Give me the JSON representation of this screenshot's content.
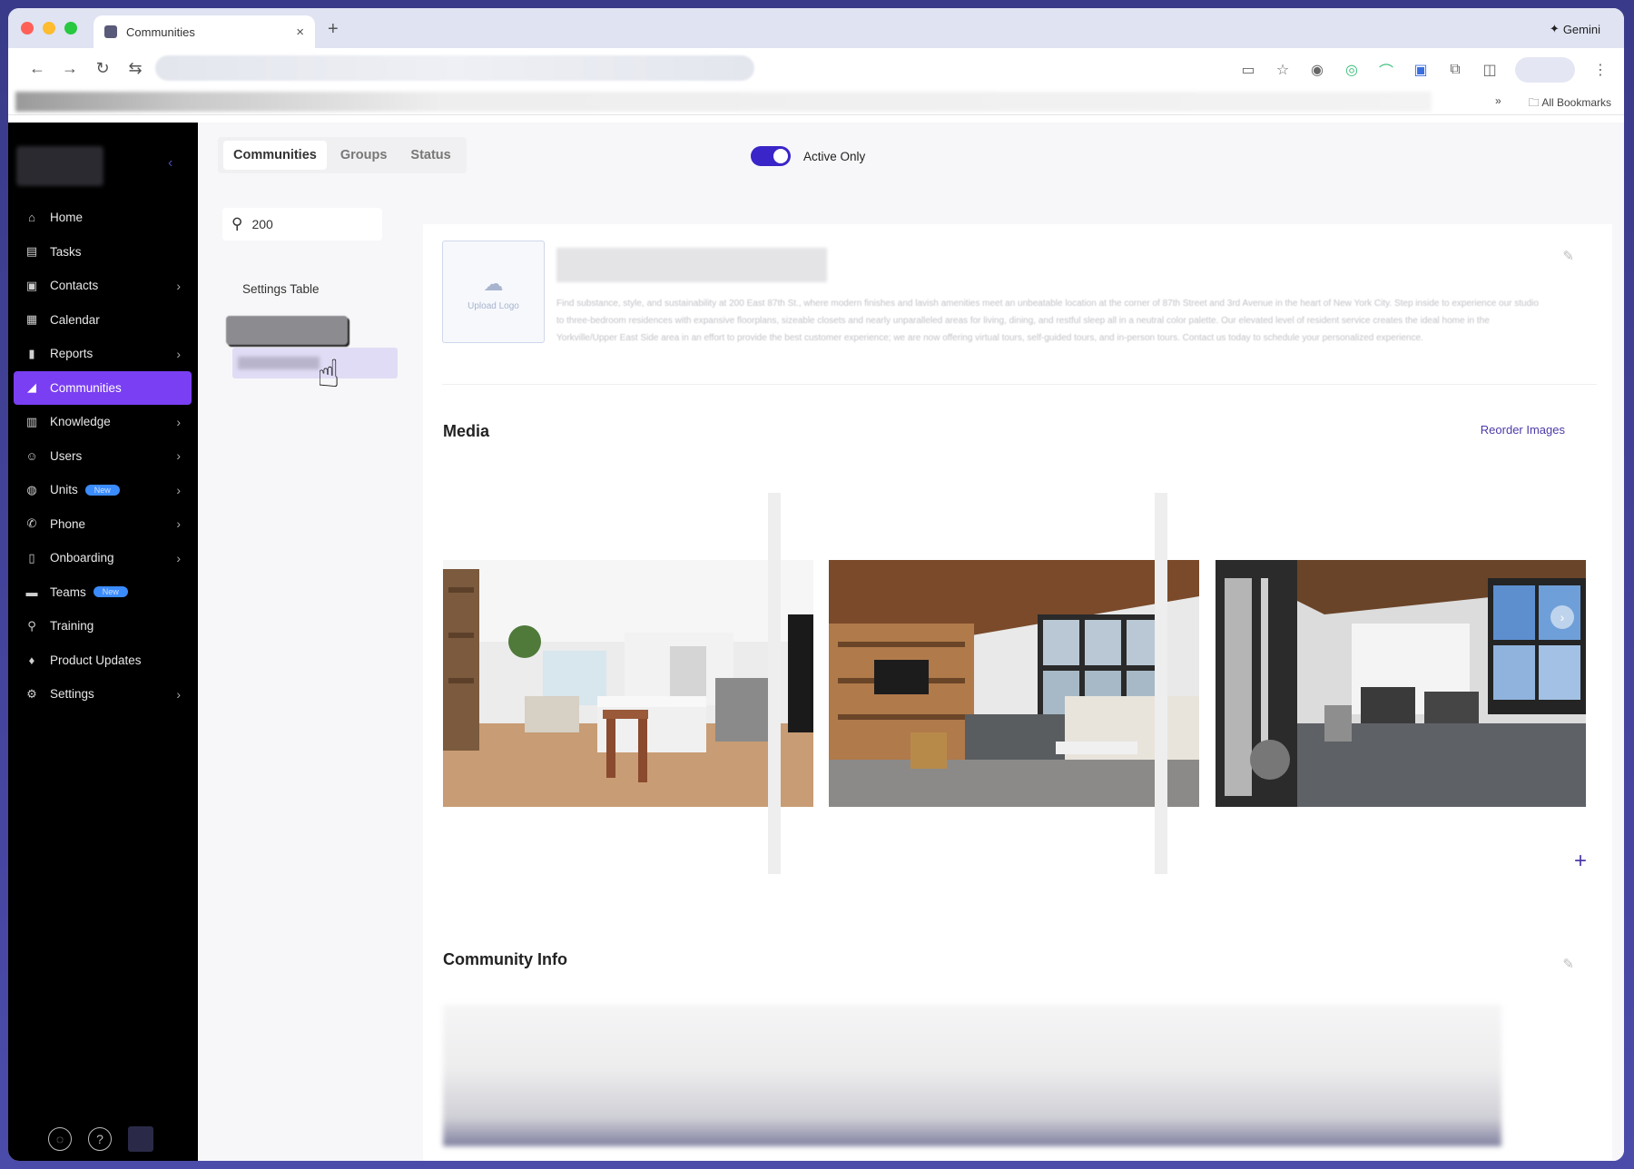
{
  "browser": {
    "tab_title": "Communities",
    "new_tab": "+",
    "tab_close": "×",
    "gemini": "Gemini",
    "bookmarks_more": "»",
    "all_bookmarks": "All Bookmarks"
  },
  "sidebar": {
    "collapse_icon": "chevron-left-icon",
    "items": [
      {
        "label": "Home",
        "icon": "home-icon",
        "chevron": false
      },
      {
        "label": "Tasks",
        "icon": "tasks-icon",
        "chevron": false
      },
      {
        "label": "Contacts",
        "icon": "contacts-icon",
        "chevron": true
      },
      {
        "label": "Calendar",
        "icon": "calendar-icon",
        "chevron": false
      },
      {
        "label": "Reports",
        "icon": "reports-icon",
        "chevron": true
      },
      {
        "label": "Communities",
        "icon": "communities-icon",
        "chevron": false,
        "active": true
      },
      {
        "label": "Knowledge",
        "icon": "knowledge-icon",
        "chevron": true
      },
      {
        "label": "Users",
        "icon": "users-icon",
        "chevron": true
      },
      {
        "label": "Units",
        "icon": "units-icon",
        "chevron": true,
        "badge": "New"
      },
      {
        "label": "Phone",
        "icon": "phone-icon",
        "chevron": true
      },
      {
        "label": "Onboarding",
        "icon": "onboarding-icon",
        "chevron": true
      },
      {
        "label": "Teams",
        "icon": "teams-icon",
        "chevron": false,
        "badge": "New"
      },
      {
        "label": "Training",
        "icon": "training-icon",
        "chevron": false
      },
      {
        "label": "Product Updates",
        "icon": "product-updates-icon",
        "chevron": false
      },
      {
        "label": "Settings",
        "icon": "settings-icon",
        "chevron": true
      }
    ]
  },
  "header": {
    "tabs": [
      "Communities",
      "Groups",
      "Status"
    ],
    "active_tab": "Communities",
    "toggle_label": "Active Only",
    "toggle_on": true
  },
  "list": {
    "search_value": "200",
    "settings_table_label": "Settings Table"
  },
  "community": {
    "upload_logo_label": "Upload Logo",
    "description": "Find substance, style, and sustainability at 200 East 87th St., where modern finishes and lavish amenities meet an unbeatable location at the corner of 87th Street and 3rd Avenue in the heart of New York City. Step inside to experience our studio to three-bedroom residences with expansive floorplans, sizeable closets and nearly unparalleled areas for living, dining, and restful sleep all in a neutral color palette. Our elevated level of resident service creates the ideal home in the Yorkville/Upper East Side area in an effort to provide the best customer experience; we are now offering virtual tours, self-guided tours, and in-person tours. Contact us today to schedule your personalized experience."
  },
  "media": {
    "title": "Media",
    "reorder_label": "Reorder Images",
    "add_label": "+",
    "next_label": "›",
    "images": [
      "kitchen-photo",
      "living-room-photo",
      "fitness-center-photo"
    ]
  },
  "community_info": {
    "title": "Community Info"
  },
  "colors": {
    "accent": "#7a3ff2",
    "toggle": "#3a25c8",
    "link": "#4b3aa8",
    "badge": "#3b8cff"
  }
}
